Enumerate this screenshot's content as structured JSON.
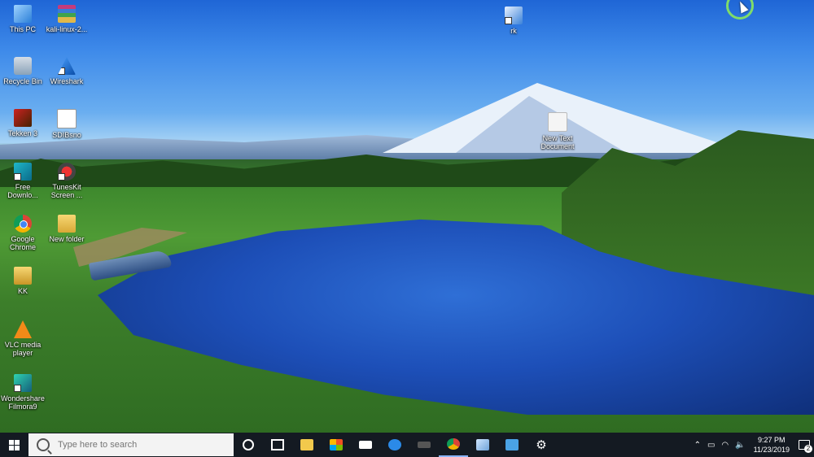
{
  "desktop_icons": [
    {
      "label": "This PC",
      "icon": "this-pc-icon"
    },
    {
      "label": "kali-linux-2...",
      "icon": "winrar-archive-icon"
    },
    {
      "label": "Recycle Bin",
      "icon": "recycle-bin-icon"
    },
    {
      "label": "Wireshark",
      "icon": "wireshark-icon"
    },
    {
      "label": "Tekken 3",
      "icon": "tekken-icon"
    },
    {
      "label": "SDIBsno",
      "icon": "sdl-icon"
    },
    {
      "label": "Free Downlo...",
      "icon": "free-download-manager-icon"
    },
    {
      "label": "TunesKit Screen ...",
      "icon": "tuneskit-icon"
    },
    {
      "label": "Google Chrome",
      "icon": "chrome-icon"
    },
    {
      "label": "New folder",
      "icon": "folder-icon"
    },
    {
      "label": "KK",
      "icon": "folder-icon"
    },
    {
      "label": "VLC media player",
      "icon": "vlc-icon"
    },
    {
      "label": "Wondershare Filmora9",
      "icon": "filmora-icon"
    },
    {
      "label": "rk",
      "icon": "rk-icon"
    },
    {
      "label": "New Text Document",
      "icon": "text-document-icon"
    }
  ],
  "taskbar": {
    "search_placeholder": "Type here to search",
    "apps": [
      "cortana-icon",
      "task-view-icon",
      "file-explorer-icon",
      "store-icon",
      "mail-icon",
      "edge-icon",
      "kali-icon",
      "chrome-icon",
      "app-icon",
      "photos-icon",
      "settings-icon"
    ],
    "tray": {
      "time": "9:27 PM",
      "date": "11/23/2019",
      "notification_count": "2"
    }
  },
  "colors": {
    "taskbar_bg": "#141a22",
    "search_bg": "#f3f3f3"
  }
}
